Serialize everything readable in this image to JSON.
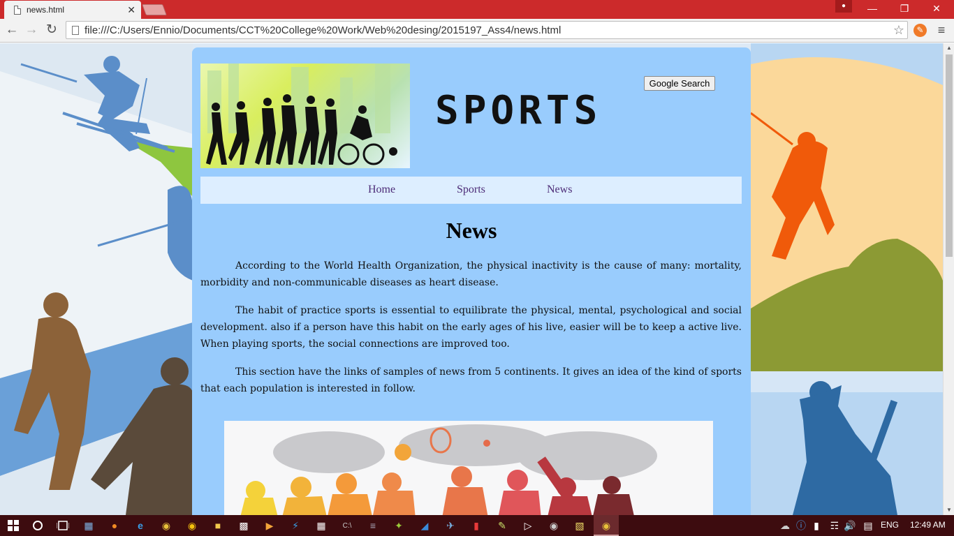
{
  "browser": {
    "tab_title": "news.html",
    "tab_close": "✕",
    "url": "file:///C:/Users/Ennio/Documents/CCT%20College%20Work/Web%20desing/2015197_Ass4/news.html",
    "back": "←",
    "forward": "→",
    "reload": "↻",
    "star": "☆",
    "menu": "≡",
    "minimize": "—",
    "restore": "❐",
    "close": "✕"
  },
  "page": {
    "site_title": "SPORTS",
    "search_button": "Google Search",
    "nav": [
      "Home",
      "Sports",
      "News"
    ],
    "heading": "News",
    "paragraphs": [
      "According to the World Health Organization, the physical inactivity is the cause of many: mortality, morbidity and non-communicable diseases as heart disease.",
      "The habit of practice sports is essential to equilibrate the physical, mental, psychological and social development. also if a person have this habit on the early ages of his live, easier will be to keep a active live. When playing sports, the social connections are improved too.",
      "This section have the links of samples of news from 5 continents. It gives an idea of the kind of sports that each population is interested in follow."
    ]
  },
  "taskbar": {
    "language": "ENG",
    "time": "12:49 AM"
  },
  "colors": {
    "titlebar": "#cc2a2b",
    "card": "#99ccfd",
    "navbar": "#ddeeff",
    "nav_link": "#4c2b77",
    "taskbar": "#3d0c0f"
  }
}
